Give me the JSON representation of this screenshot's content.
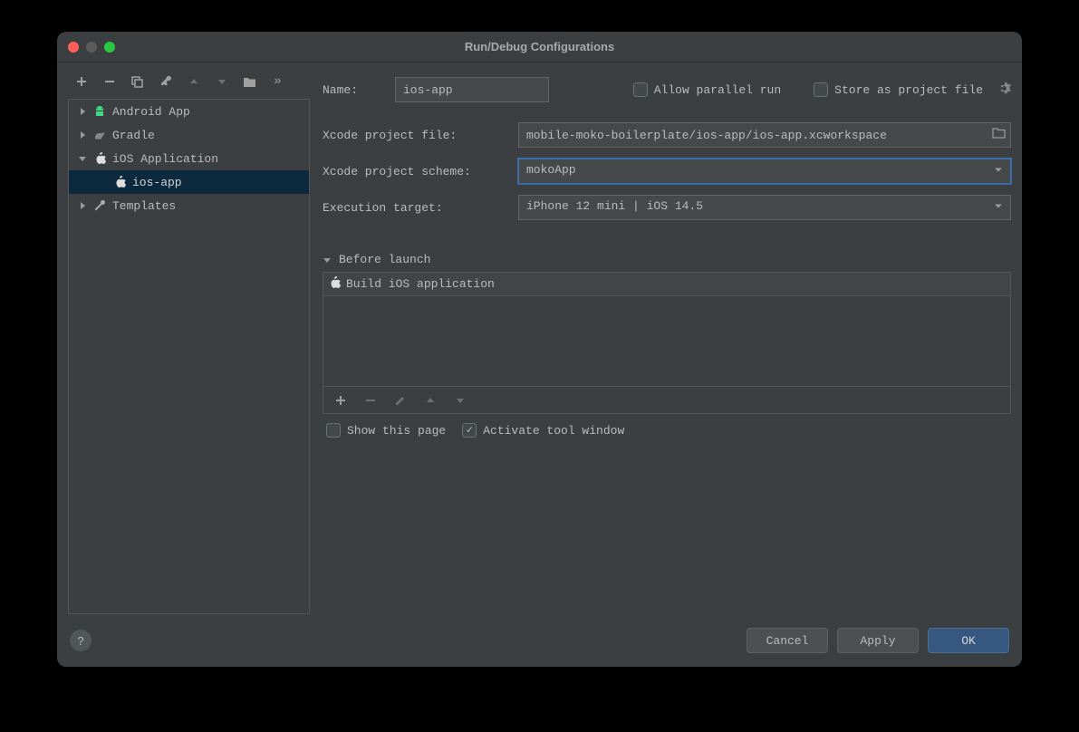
{
  "title": "Run/Debug Configurations",
  "tree": {
    "items": [
      {
        "label": "Android App",
        "expanded": false
      },
      {
        "label": "Gradle",
        "expanded": false
      },
      {
        "label": "iOS Application",
        "expanded": true
      },
      {
        "label": "ios-app"
      },
      {
        "label": "Templates",
        "expanded": false
      }
    ]
  },
  "form": {
    "name_label": "Name:",
    "name_value": "ios-app",
    "allow_parallel_label": "Allow parallel run",
    "store_project_label": "Store as project file",
    "xcode_file_label": "Xcode project file:",
    "xcode_file_value": "mobile-moko-boilerplate/ios-app/ios-app.xcworkspace",
    "xcode_scheme_label": "Xcode project scheme:",
    "xcode_scheme_value": "mokoApp",
    "exec_target_label": "Execution target:",
    "exec_target_value": "iPhone 12 mini | iOS 14.5"
  },
  "before_launch": {
    "header": "Before launch",
    "tasks": [
      "Build iOS application"
    ],
    "show_page_label": "Show this page",
    "activate_window_label": "Activate tool window"
  },
  "footer": {
    "cancel": "Cancel",
    "apply": "Apply",
    "ok": "OK"
  }
}
